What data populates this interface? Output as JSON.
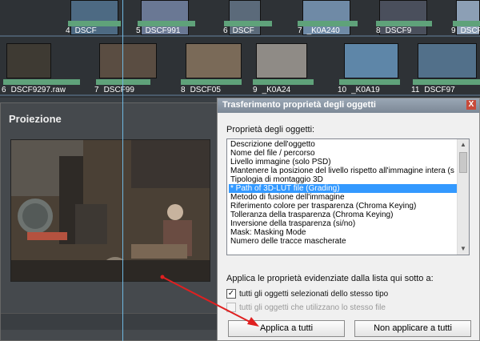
{
  "timeline": {
    "top_row": [
      {
        "num": "4",
        "name": "DSCF"
      },
      {
        "num": "5",
        "name": "DSCF991"
      },
      {
        "num": "6",
        "name": "DSCF"
      },
      {
        "num": "7",
        "name": "_K0A240"
      },
      {
        "num": "8",
        "name": "DSCF9"
      },
      {
        "num": "9",
        "name": "DSCF"
      }
    ],
    "bottom_row": [
      {
        "num": "6",
        "name": "DSCF9297.raw"
      },
      {
        "num": "7",
        "name": "DSCF99"
      },
      {
        "num": "8",
        "name": "DSCF05"
      },
      {
        "num": "9",
        "name": "_K0A24"
      },
      {
        "num": "10",
        "name": "_K0A19"
      },
      {
        "num": "11",
        "name": "DSCF97"
      }
    ]
  },
  "projection": {
    "title": "Proiezione"
  },
  "dialog": {
    "title": "Trasferimento proprietà degli oggetti",
    "close_label": "X",
    "properties_label": "Proprietà degli oggetti:",
    "properties": [
      "Descrizione dell'oggetto",
      "Nome del file / percorso",
      "Livello immagine (solo PSD)",
      "Mantenere la posizione del livello rispetto all'immagine intera (s",
      "Tipologia di montaggio 3D",
      "* Path of 3D-LUT file (Grading)",
      "Metodo di fusione dell'immagine",
      "Riferimento colore per trasparenza (Chroma Keying)",
      "Tolleranza della trasparenza (Chroma Keying)",
      "Inversione della trasparenza (si/no)",
      "Mask: Masking Mode",
      "Numero delle tracce mascherate"
    ],
    "selected_index": 5,
    "apply_label": "Applica le proprietà evidenziate dalla lista qui sotto a:",
    "option_same_type": "tutti gli oggetti selezionati dello stesso tipo",
    "option_same_type_checked": true,
    "option_same_file": "tutti gli oggetti che utilizzano lo stesso file",
    "option_same_file_checked": false,
    "apply_all_button": "Applica a tutti",
    "no_apply_button": "Non applicare a tutti"
  },
  "colors": {
    "selection": "#3399ff",
    "arrow": "#e02020",
    "clip_bar": "#5fa27a"
  }
}
